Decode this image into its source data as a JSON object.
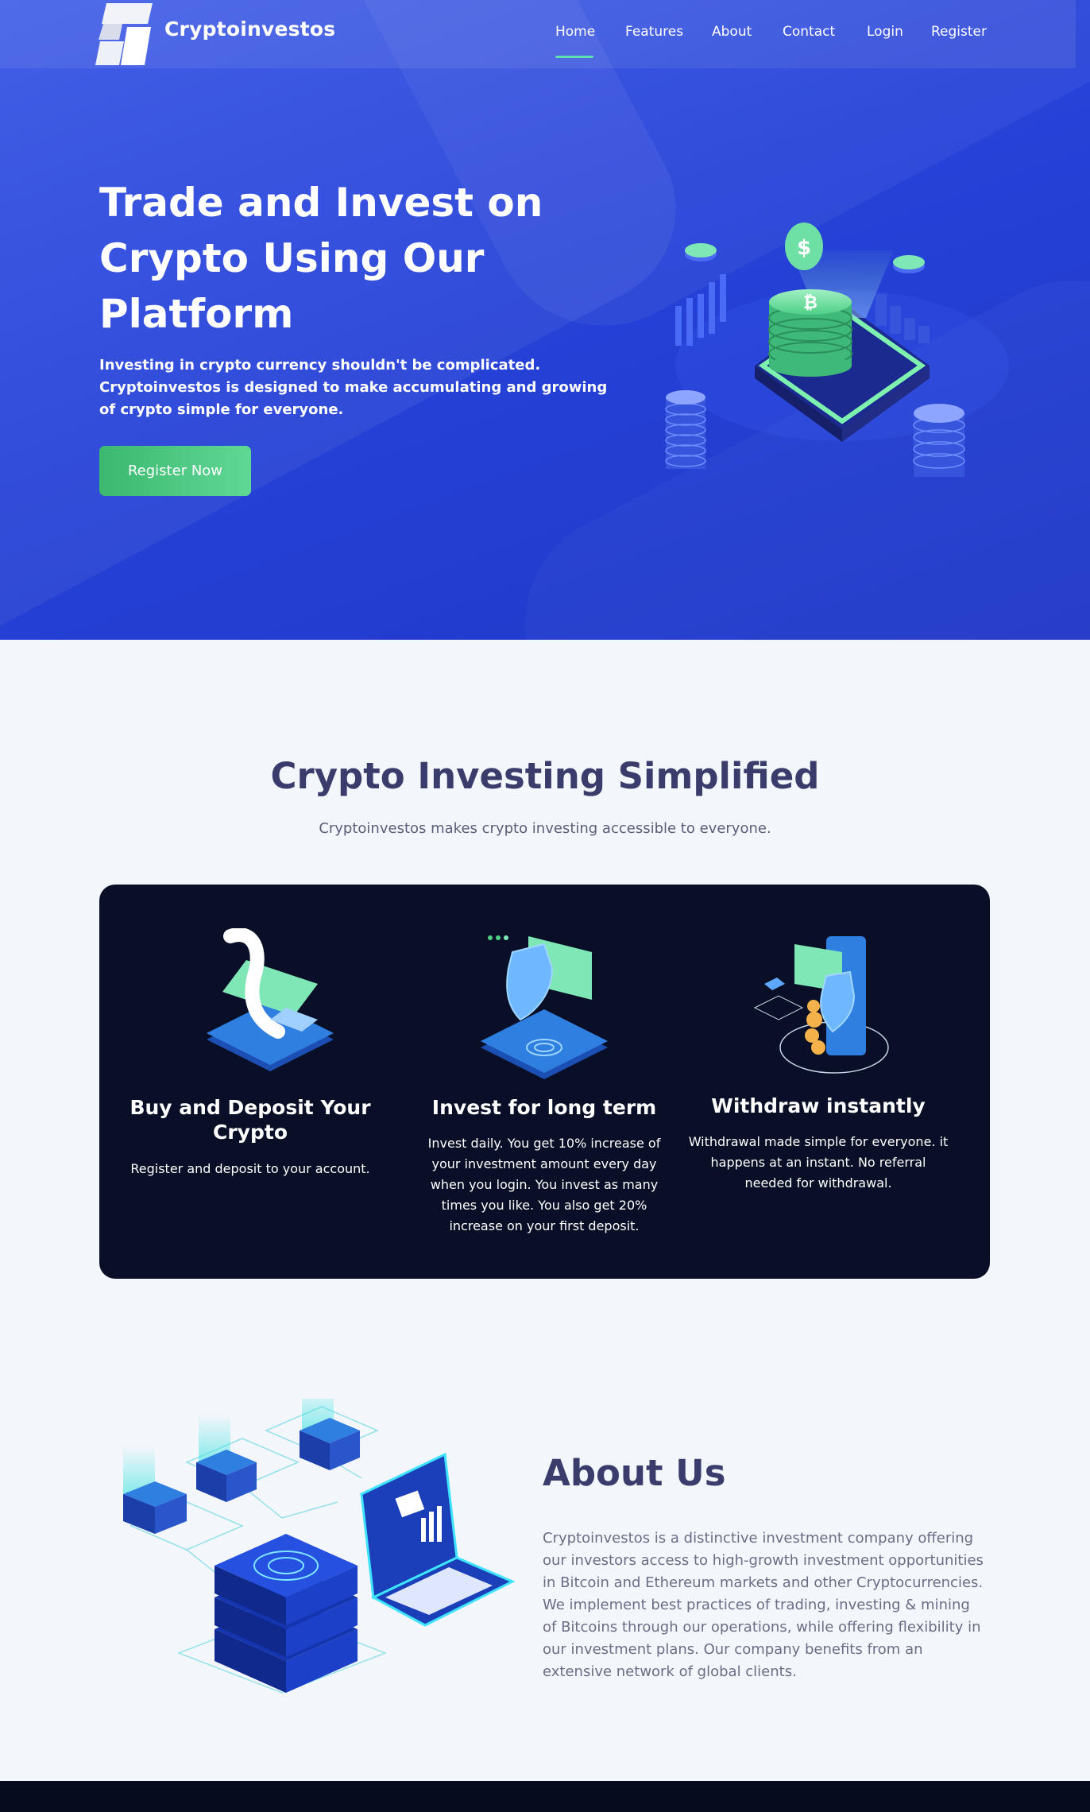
{
  "brand": {
    "name": "Cryptoinvestos"
  },
  "nav": {
    "items": [
      {
        "label": "Home",
        "active": true
      },
      {
        "label": "Features"
      },
      {
        "label": "About"
      },
      {
        "label": "Contact"
      },
      {
        "label": "Login"
      },
      {
        "label": "Register"
      }
    ]
  },
  "hero": {
    "title": "Trade and Invest on Crypto Using Our Platform",
    "subtitle": "Investing in crypto currency shouldn't be complicated. Cryptoinvestos is designed to make accumulating and growing of crypto simple for everyone.",
    "cta_label": "Register Now"
  },
  "simplified": {
    "title": "Crypto Investing Simplified",
    "subtitle": "Cryptoinvestos makes crypto investing accessible to everyone.",
    "features": [
      {
        "title": "Buy and Deposit Your Crypto",
        "text": "Register and deposit to your account."
      },
      {
        "title": "Invest for long term",
        "text": "Invest daily. You get 10% increase of your investment amount every day when you login. You invest as many times you like. You also get 20% increase on your first deposit."
      },
      {
        "title": "Withdraw instantly",
        "text": "Withdrawal made simple for everyone. it happens at an instant. No referral needed for withdrawal."
      }
    ]
  },
  "about": {
    "title": "About Us",
    "text": "Cryptoinvestos is a distinctive investment company offering our investors access to high-growth investment opportunities in Bitcoin and Ethereum markets and other Cryptocurrencies. We implement best practices of trading, investing & mining of Bitcoins through our operations, while offering flexibility in our investment plans. Our company benefits from an extensive network of global clients."
  },
  "colors": {
    "hero_blue": "#2642d8",
    "accent_green": "#4fcf85",
    "dark_card": "#090f26",
    "heading": "#3a3d6b"
  }
}
